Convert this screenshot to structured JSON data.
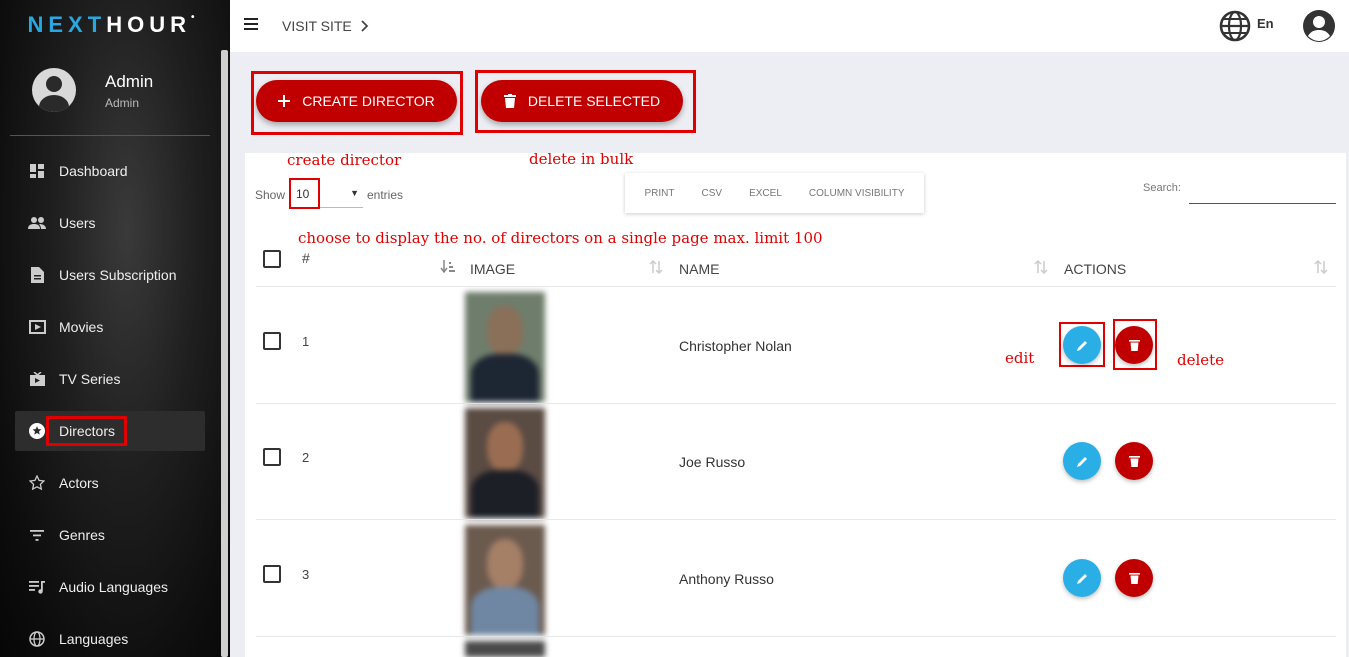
{
  "brand": {
    "part1": "NEXT",
    "part2": "HOUR",
    "mark": "•"
  },
  "profile": {
    "name": "Admin",
    "role": "Admin"
  },
  "sidebar": {
    "items": [
      {
        "label": "Dashboard",
        "icon": "dashboard-icon"
      },
      {
        "label": "Users",
        "icon": "users-icon"
      },
      {
        "label": "Users Subscription",
        "icon": "document-icon"
      },
      {
        "label": "Movies",
        "icon": "movie-icon"
      },
      {
        "label": "TV Series",
        "icon": "tv-icon"
      },
      {
        "label": "Directors",
        "icon": "star-circle-icon",
        "active": true
      },
      {
        "label": "Actors",
        "icon": "star-outline-icon"
      },
      {
        "label": "Genres",
        "icon": "filter-icon"
      },
      {
        "label": "Audio Languages",
        "icon": "playlist-icon"
      },
      {
        "label": "Languages",
        "icon": "globe-icon"
      }
    ]
  },
  "topbar": {
    "visit": "VISIT SITE",
    "lang": "En"
  },
  "actions": {
    "create": "CREATE DIRECTOR",
    "delete": "DELETE SELECTED"
  },
  "annotations": {
    "create": "create director",
    "bulk": "delete in bulk",
    "entries": "choose to display the no. of directors on a single page max. limit 100",
    "edit": "edit",
    "delete": "delete"
  },
  "table_controls": {
    "show": "Show",
    "entries_value": "10",
    "entries": "entries",
    "export": [
      "PRINT",
      "CSV",
      "EXCEL",
      "COLUMN VISIBILITY"
    ],
    "search": "Search:"
  },
  "columns": {
    "num": "#",
    "image": "IMAGE",
    "name": "NAME",
    "actions": "ACTIONS"
  },
  "rows": [
    {
      "num": "1",
      "name": "Christopher Nolan"
    },
    {
      "num": "2",
      "name": "Joe Russo"
    },
    {
      "num": "3",
      "name": "Anthony Russo"
    }
  ],
  "colors": {
    "accent": "#c00000",
    "edit": "#2aaee6",
    "annotation": "#e00000",
    "brand_blue": "#27a8e0"
  }
}
